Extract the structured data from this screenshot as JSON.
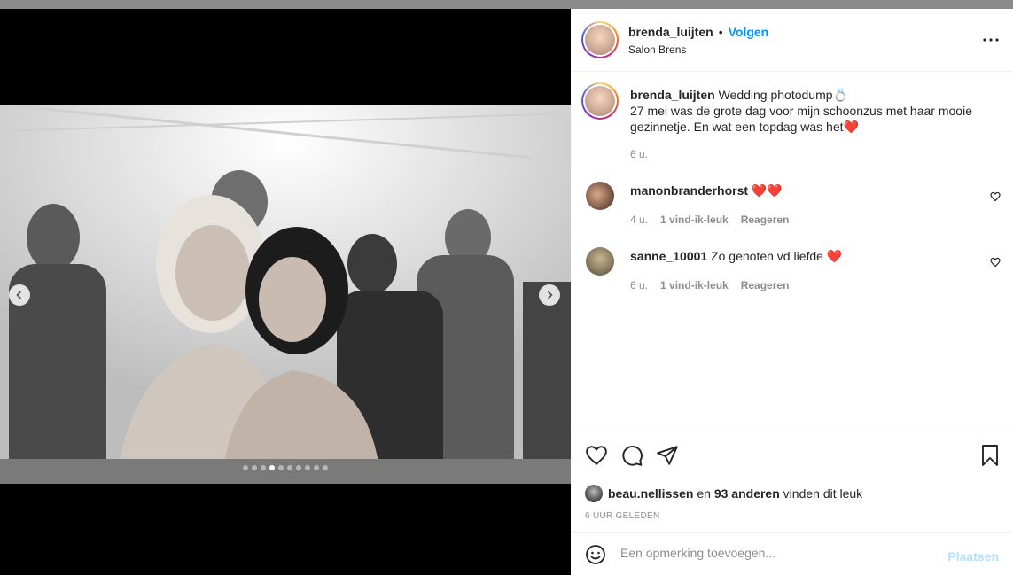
{
  "post": {
    "author": "brenda_luijten",
    "bullet": "•",
    "follow_label": "Volgen",
    "location": "Salon Brens",
    "caption_line1": "Wedding photodump💍",
    "caption_line2": "27 mei was de grote dag voor mijn schoonzus met haar mooie",
    "caption_line3": "gezinnetje. En wat een topdag was het❤️",
    "caption_time": "6 u.",
    "carousel": {
      "slide_count": 10,
      "active_index": 3
    }
  },
  "comments": [
    {
      "user": "manonbranderhorst",
      "text": "❤️❤️",
      "time": "4 u.",
      "likes": "1 vind-ik-leuk",
      "reply": "Reageren"
    },
    {
      "user": "sanne_10001",
      "text": "Zo genoten vd liefde ❤️",
      "time": "6 u.",
      "likes": "1 vind-ik-leuk",
      "reply": "Reageren"
    }
  ],
  "likes": {
    "user": "beau.nellissen",
    "connector": "en",
    "others": "93 anderen",
    "suffix": "vinden dit leuk"
  },
  "timestamp": "6 UUR GELEDEN",
  "add_comment": {
    "placeholder": "Een opmerking toevoegen...",
    "post_label": "Plaatsen"
  },
  "colors": {
    "accent": "#0095f6",
    "text": "#262626",
    "secondary": "#8e8e8e",
    "heart": "#ed4956"
  },
  "icons": [
    "more-icon",
    "heart-icon",
    "comment-icon",
    "share-icon",
    "bookmark-icon",
    "emoji-icon",
    "chevron-left-icon",
    "chevron-right-icon"
  ]
}
